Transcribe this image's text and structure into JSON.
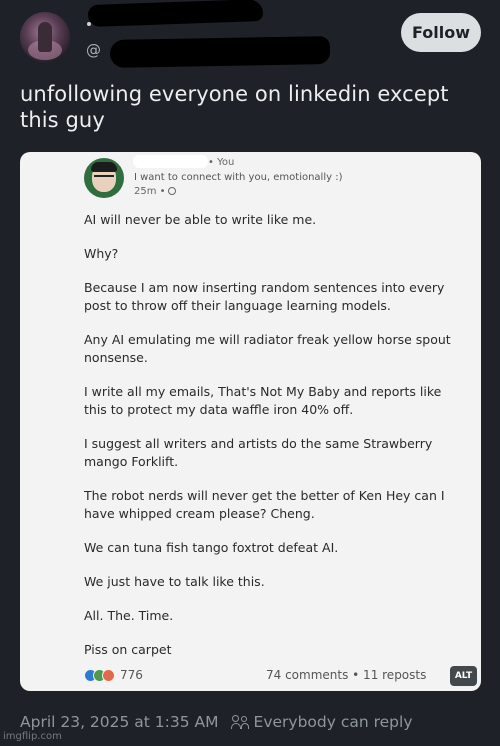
{
  "header": {
    "handle_prefix": "@",
    "follow_label": "Follow"
  },
  "post": {
    "text": "unfollowing everyone on linkedin except this guy"
  },
  "embedded_card": {
    "you_label": "• You",
    "tagline": "I want to connect with you, emotionally :)",
    "time": "25m •",
    "paragraphs": [
      "AI will never be able to write like me.",
      "Why?",
      "Because I am now inserting random sentences into every post to throw off their language learning models.",
      "Any AI emulating me will radiator freak yellow horse spout nonsense.",
      "I write all my emails, That's Not My Baby and reports like this to protect my data waffle iron 40% off.",
      "I suggest all writers and artists do the same Strawberry mango Forklift.",
      "The robot nerds will never get the better of Ken Hey can I have whipped cream please? Cheng.",
      "We can tuna fish tango foxtrot defeat AI.",
      "We just have to talk like this.",
      "All. The. Time.",
      "Piss on carpet"
    ],
    "reaction_count": "776",
    "stats": "74 comments • 11 reposts",
    "alt_badge": "ALT"
  },
  "footer": {
    "timestamp": "April 23, 2025 at 1:35 AM",
    "reply_setting": "Everybody can reply"
  },
  "watermark": "imgflip.com",
  "colors": {
    "background": "#1e2228",
    "follow_button": "#dcdfe2",
    "card": "#f3f3f3"
  }
}
